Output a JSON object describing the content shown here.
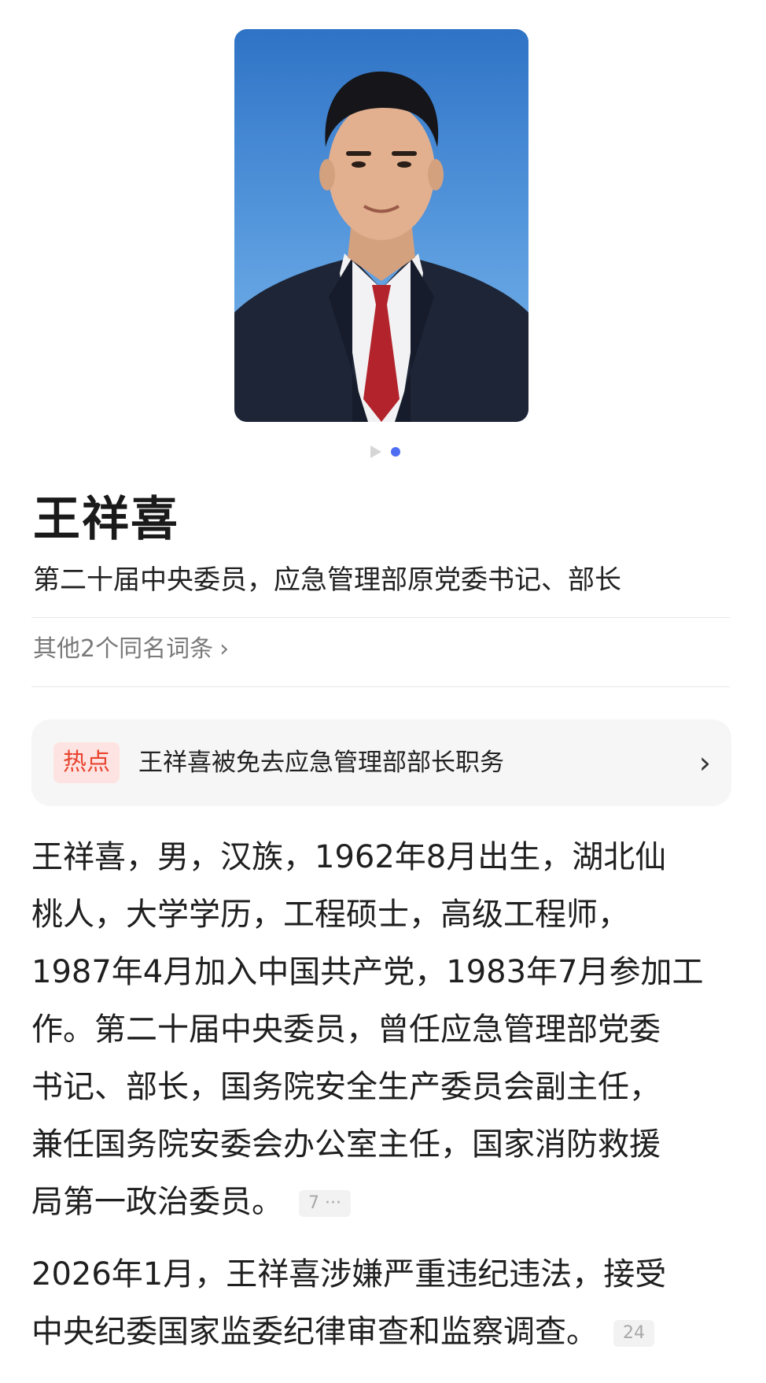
{
  "person": {
    "name": "王祥喜",
    "subtitle": "第二十届中央委员，应急管理部原党委书记、部长",
    "other_entries": "其他2个同名词条",
    "other_entries_icon": "chevron-right-icon"
  },
  "carousel": {
    "count": 2,
    "active_index": 1
  },
  "hot": {
    "badge": "热点",
    "text": "王祥喜被免去应急管理部部长职务",
    "icon": "chevron-right-icon"
  },
  "summary": {
    "lines": [
      "王祥喜，男，汉族，1962年8月出生，湖北仙",
      "桃人，大学学历，工程硕士，高级工程师，",
      "1987年4月加入中国共产党，1983年7月参加工",
      "作。第二十届中央委员，曾任应急管理部党委",
      "书记、部长，国务院安全生产委员会副主任，",
      "兼任国务院安委会办公室主任，国家消防救援",
      "局第一政治委员。"
    ],
    "citation": "7 ···"
  },
  "update": {
    "lines": [
      "2026年1月，王祥喜涉嫌严重违纪违法，接受",
      "中央纪委国家监委纪律审查和监察调查。"
    ],
    "citation": "24"
  },
  "colors": {
    "accent": "#4e6ef2",
    "hot_red": "#e8432e",
    "hot_bg": "#fde4e2",
    "card_bg": "#f6f6f6"
  }
}
